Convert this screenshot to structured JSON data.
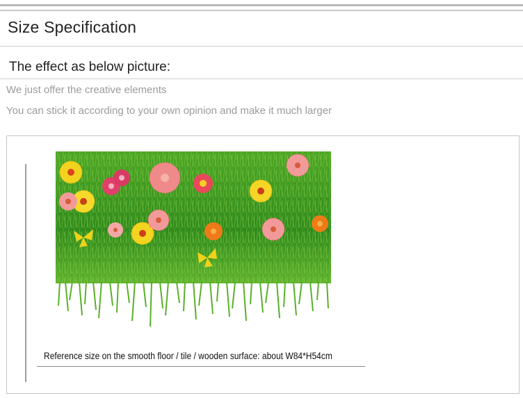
{
  "heading": {
    "title": "Size Specification"
  },
  "effect": {
    "heading": "The effect as below picture:",
    "notes": [
      "We just offer the creative elements",
      "You can stick it according to your own opinion and make it much larger"
    ]
  },
  "product": {
    "image_subject": "grass-with-flowers-sticker",
    "caption": "Reference size on the smooth floor / tile / wooden surface: about W84*H54cm"
  },
  "colors": {
    "grass_dark": "#2f8a1c",
    "grass_light": "#7fc93a",
    "flower_yellow": "#f3d21e",
    "flower_pink": "#f08a8a",
    "flower_orange": "#f07a18",
    "flower_magenta": "#e0406a"
  }
}
